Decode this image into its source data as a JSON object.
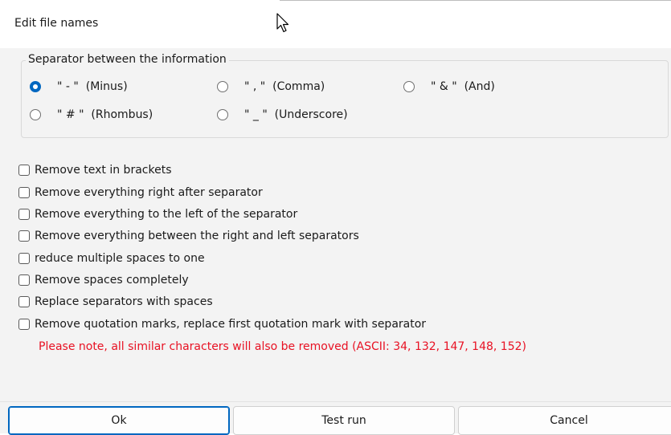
{
  "window": {
    "title": "Edit file names"
  },
  "separator_group": {
    "legend": "Separator between the information",
    "options": [
      {
        "label": "\" - \"  (Minus)",
        "selected": true
      },
      {
        "label": "\" , \"  (Comma)",
        "selected": false
      },
      {
        "label": "\" & \"  (And)",
        "selected": false
      },
      {
        "label": "\" # \"  (Rhombus)",
        "selected": false
      },
      {
        "label": "\" _ \"  (Underscore)",
        "selected": false
      }
    ]
  },
  "options": [
    {
      "label": "Remove text in brackets",
      "checked": false
    },
    {
      "label": "Remove everything right after separator",
      "checked": false
    },
    {
      "label": "Remove everything to the left of the separator",
      "checked": false
    },
    {
      "label": "Remove everything between the right and left separators",
      "checked": false
    },
    {
      "label": "reduce multiple spaces to one",
      "checked": false
    },
    {
      "label": "Remove spaces completely",
      "checked": false
    },
    {
      "label": "Replace separators with spaces",
      "checked": false
    },
    {
      "label": "Remove quotation marks, replace first quotation mark with separator",
      "checked": false
    }
  ],
  "note": "Please note, all similar characters will also be removed (ASCII: 34, 132, 147, 148, 152)",
  "buttons": {
    "ok": "Ok",
    "test_run": "Test run",
    "cancel": "Cancel"
  },
  "colors": {
    "accent": "#0067c0",
    "warning_text": "#e81123",
    "background": "#f3f3f3"
  }
}
